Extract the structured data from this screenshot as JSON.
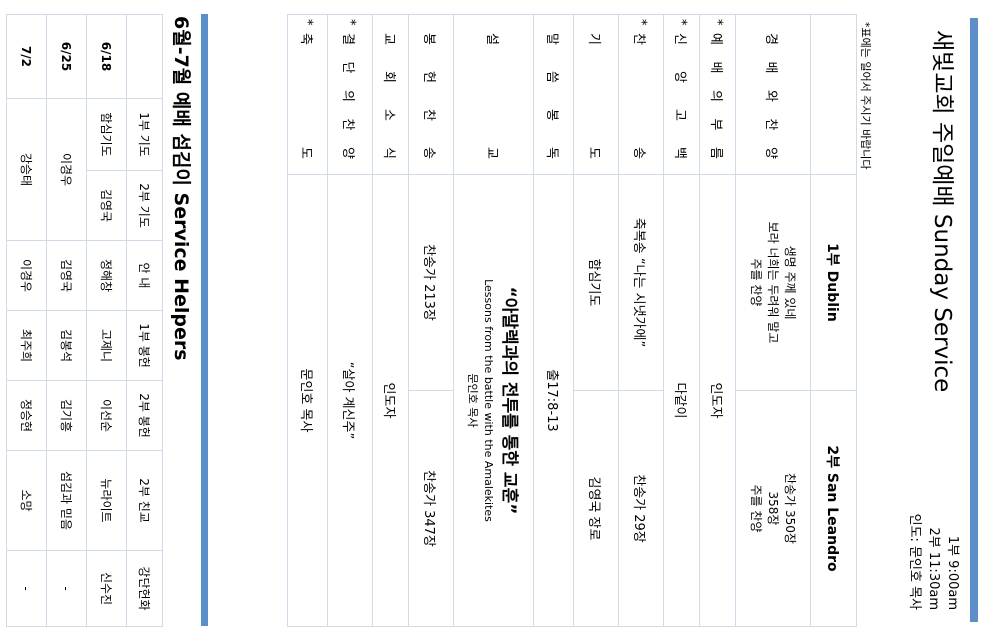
{
  "header": {
    "title": "새빛교회 주일예배 Sunday Service",
    "times": [
      "1부 9:00am",
      "2부 11:30am",
      "인도: 문인호 목사"
    ],
    "note": "*표에는 일어서 주시기 바랍니다"
  },
  "service": {
    "col1": "1부 Dublin",
    "col2": "2부 San Leandro",
    "rows": [
      {
        "star": "",
        "label": "경배와 찬양",
        "c1": [
          "생명 주께 있네",
          "보라 너희는 두려워 말고",
          "주를 찬양"
        ],
        "c2": [
          "찬송가 350장",
          "358장",
          "주를 찬양"
        ],
        "span": false
      },
      {
        "star": "*",
        "label": "예배의 부름",
        "c1": [
          "인도자"
        ],
        "span": true
      },
      {
        "star": "*",
        "label": "신앙고백",
        "c1": [
          "다같이"
        ],
        "span": true
      },
      {
        "star": "*",
        "label": "찬송",
        "c1": [
          "축복송 “나는 시냇가에”"
        ],
        "c2": [
          "찬송가 29장"
        ],
        "span": false
      },
      {
        "star": "",
        "label": "기도",
        "c1": [
          "함심기도"
        ],
        "c2": [
          "김영국 장로"
        ],
        "span": false
      },
      {
        "star": "",
        "label": "말씀봉독",
        "c1": [
          "출17:8-13"
        ],
        "span": true
      },
      {
        "star": "",
        "label": "설교",
        "sermon": "“아말렉과의 전투를 통한 교훈”",
        "c1": [
          "Lessons from the battle with the Amalekites",
          "문인호 목사"
        ],
        "span": true
      },
      {
        "star": "",
        "label": "봉헌찬송",
        "c1": [
          "찬송가 213장"
        ],
        "c2": [
          "찬송가 347장"
        ],
        "span": false
      },
      {
        "star": "",
        "label": "교회소식",
        "c1": [
          "인도자"
        ],
        "span": true
      },
      {
        "star": "*",
        "label": "결단의 찬양",
        "c1": [
          "“살아 계신주”"
        ],
        "span": true
      },
      {
        "star": "*",
        "label": "축도",
        "c1": [
          "문인호 목사"
        ],
        "span": true
      }
    ]
  },
  "helpers": {
    "title": "6월-7월 예배 섬김이 Service Helpers",
    "headers": [
      "",
      "1부 기도",
      "2부 기도",
      "안 내",
      "1부 봉헌",
      "2부 봉헌",
      "2부 친교",
      "강단헌화"
    ],
    "rows": [
      {
        "date": "6/18",
        "cells": [
          "함심기도",
          "김영국",
          "정해창",
          "고제니",
          "이선순",
          "뉴라이트",
          "신수진"
        ]
      },
      {
        "date": "6/25",
        "merged": "이경우",
        "cells": [
          "김영국",
          "김봉석",
          "김기흥",
          "섬김과 믿음",
          "-"
        ]
      },
      {
        "date": "7/2",
        "merged": "강승태",
        "cells": [
          "이경우",
          "최주희",
          "정승현",
          "소망",
          "-"
        ]
      }
    ]
  },
  "colors": {
    "accent": "#5b8fc9",
    "grid": "#cfdbe6"
  }
}
